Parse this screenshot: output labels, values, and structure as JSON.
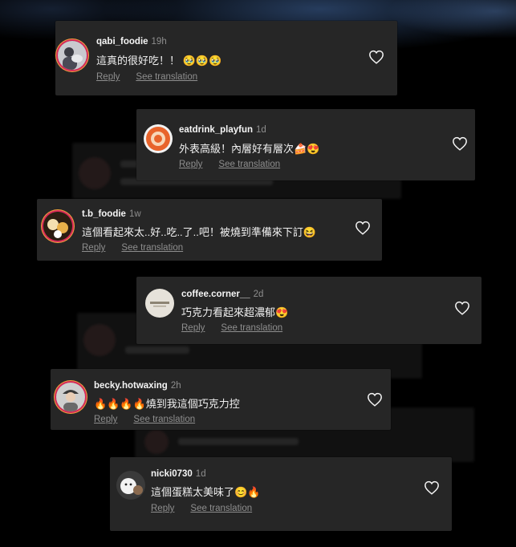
{
  "comments": [
    {
      "username": "qabi_foodie",
      "time": "19h",
      "text": "這真的很好吃！！ 🥹🥹🥹",
      "reply_label": "Reply",
      "translate_label": "See translation",
      "avatar_icon": "person-with-pet-avatar"
    },
    {
      "username": "eatdrink_playfun",
      "time": "1d",
      "text": "外表高級！內層好有層次🍰😍",
      "reply_label": "Reply",
      "translate_label": "See translation",
      "avatar_icon": "orange-flower-logo-avatar"
    },
    {
      "username": "t.b_foodie",
      "time": "1w",
      "text": "這個看起來太..好..吃..了..吧！被燒到準備來下訂😆",
      "reply_label": "Reply",
      "translate_label": "See translation",
      "avatar_icon": "cartoon-characters-avatar"
    },
    {
      "username": "coffee.corner__",
      "time": "2d",
      "text": "巧克力看起來超濃郁😍",
      "reply_label": "Reply",
      "translate_label": "See translation",
      "avatar_icon": "cafe-logo-avatar"
    },
    {
      "username": "becky.hotwaxing",
      "time": "2h",
      "text": "🔥🔥🔥🔥燒到我這個巧克力控",
      "reply_label": "Reply",
      "translate_label": "See translation",
      "avatar_icon": "person-with-cap-avatar"
    },
    {
      "username": "nicki0730",
      "time": "1d",
      "text": "這個蛋糕太美味了😊🔥",
      "reply_label": "Reply",
      "translate_label": "See translation",
      "avatar_icon": "white-dog-avatar"
    }
  ],
  "colors": {
    "card_bg": "#262626",
    "muted": "#8e8e8e",
    "text": "#f5f5f5",
    "story_ring_start": "#d6285a",
    "story_ring_end": "#f1a33c"
  },
  "icons": {
    "like": "heart-outline-icon"
  }
}
